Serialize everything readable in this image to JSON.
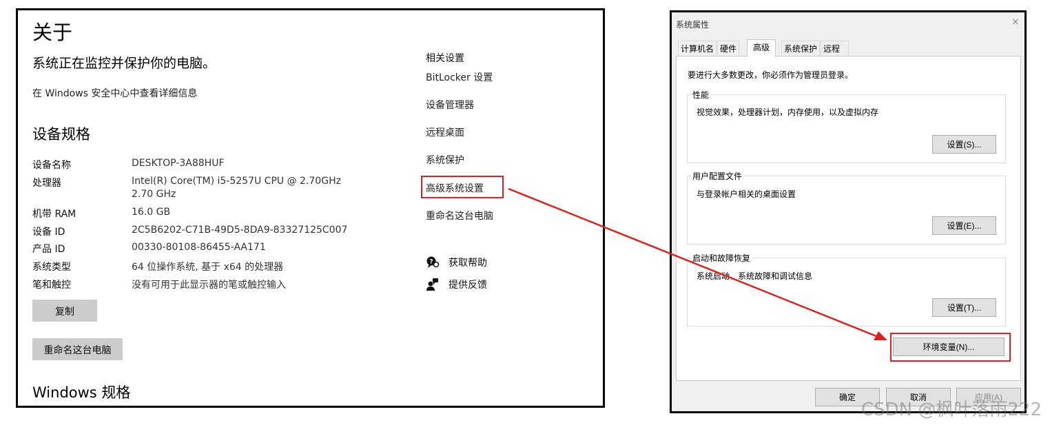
{
  "about": {
    "title": "关于",
    "headline": "系统正在监控并保护你的电脑。",
    "security_link": "在 Windows 安全中心中查看详细信息",
    "device_specs_title": "设备规格",
    "specs": [
      {
        "label": "设备名称",
        "value": "DESKTOP-3A88HUF"
      },
      {
        "label": "处理器",
        "value": "Intel(R) Core(TM) i5-5257U CPU @ 2.70GHz   2.70 GHz"
      },
      {
        "label": "机带 RAM",
        "value": "16.0 GB"
      },
      {
        "label": "设备 ID",
        "value": "2C5B6202-C71B-49D5-8DA9-83327125C007"
      },
      {
        "label": "产品 ID",
        "value": "00330-80108-86455-AA171"
      },
      {
        "label": "系统类型",
        "value": "64 位操作系统, 基于 x64 的处理器"
      },
      {
        "label": "笔和触控",
        "value": "没有可用于此显示器的笔或触控输入"
      }
    ],
    "copy_button": "复制",
    "rename_button": "重命名这台电脑",
    "windows_spec_title": "Windows 规格",
    "related": {
      "title": "相关设置",
      "links": [
        "BitLocker 设置",
        "设备管理器",
        "远程桌面",
        "系统保护",
        "高级系统设置",
        "重命名这台电脑"
      ]
    },
    "help": {
      "get_help": "获取帮助",
      "feedback": "提供反馈"
    }
  },
  "dialog": {
    "title": "系统属性",
    "close": "×",
    "tabs": [
      "计算机名",
      "硬件",
      "高级",
      "系统保护",
      "远程"
    ],
    "active_tab": "高级",
    "admin_note": "要进行大多数更改，你必须作为管理员登录。",
    "groups": [
      {
        "title": "性能",
        "desc": "视觉效果，处理器计划，内存使用，以及虚拟内存",
        "button": "设置(S)..."
      },
      {
        "title": "用户配置文件",
        "desc": "与登录帐户相关的桌面设置",
        "button": "设置(E)..."
      },
      {
        "title": "启动和故障恢复",
        "desc": "系统启动、系统故障和调试信息",
        "button": "设置(T)..."
      }
    ],
    "env_button": "环境变量(N)...",
    "ok": "确定",
    "cancel": "取消",
    "apply": "应用(A)"
  },
  "annotation_color": "#e02020",
  "watermark": "CSDN @枫叶落雨222"
}
